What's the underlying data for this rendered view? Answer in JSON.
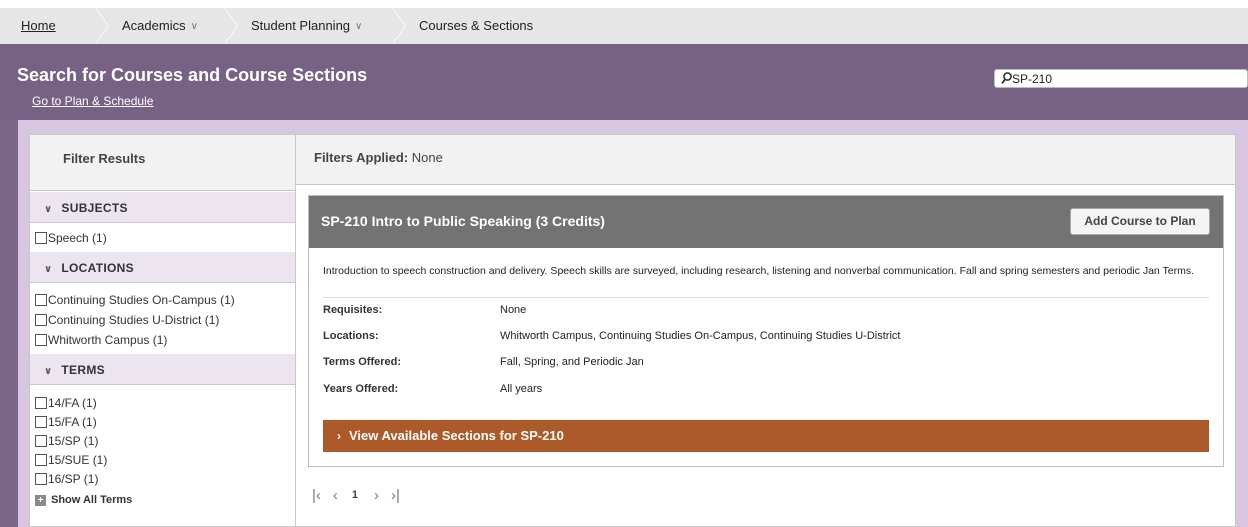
{
  "breadcrumb": {
    "items": [
      {
        "label": "Home"
      },
      {
        "label": "Academics"
      },
      {
        "label": "Student Planning"
      },
      {
        "label": "Courses & Sections"
      }
    ]
  },
  "header": {
    "title": "Search for Courses and Course Sections",
    "plan_link": "Go to Plan & Schedule",
    "search_value": "SP-210"
  },
  "filters": {
    "heading": "Filter Results",
    "sections": [
      {
        "title": "SUBJECTS",
        "options": [
          "Speech (1)"
        ]
      },
      {
        "title": "LOCATIONS",
        "options": [
          "Continuing Studies On-Campus (1)",
          "Continuing Studies U-District (1)",
          "Whitworth Campus (1)"
        ]
      },
      {
        "title": "TERMS",
        "options": [
          "14/FA (1)",
          "15/FA (1)",
          "15/SP (1)",
          "15/SUE (1)",
          "16/SP (1)"
        ]
      }
    ],
    "show_all_terms": "Show All Terms"
  },
  "results": {
    "applied_label": "Filters Applied:",
    "applied_value": "None",
    "course": {
      "title": "SP-210 Intro to Public Speaking (3 Credits)",
      "add_button": "Add Course to Plan",
      "description": "Introduction to speech construction and delivery. Speech skills are surveyed, including research, listening and nonverbal communication. Fall and spring semesters and periodic Jan Terms.",
      "details": [
        {
          "label": "Requisites:",
          "value": "None"
        },
        {
          "label": "Locations:",
          "value": "Whitworth Campus, Continuing Studies On-Campus, Continuing Studies U-District"
        },
        {
          "label": "Terms Offered:",
          "value": "Fall, Spring, and Periodic Jan"
        },
        {
          "label": "Years Offered:",
          "value": "All years"
        }
      ],
      "sections_label": "View Available Sections for SP-210"
    },
    "pagination": {
      "current_page": "1"
    }
  },
  "colors": {
    "header_bg": "#776285",
    "frame_bg": "#d8c6e1",
    "course_header_bg": "#737373",
    "sections_bar_bg": "#ac5a2a"
  }
}
